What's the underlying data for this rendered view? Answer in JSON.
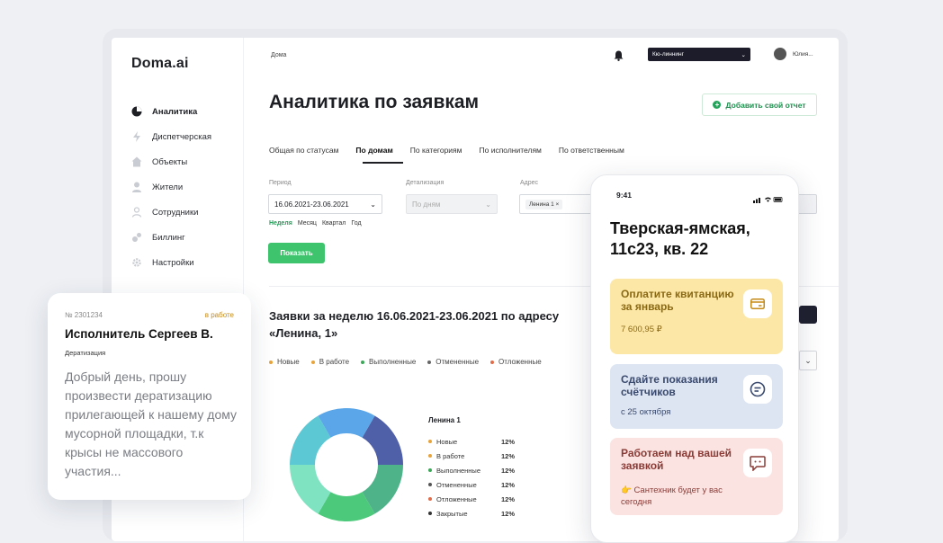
{
  "app": {
    "logo": "Doma.ai",
    "sidebar": [
      {
        "label": "Аналитика",
        "icon": "pie-chart-icon",
        "active": true
      },
      {
        "label": "Диспетчерская",
        "icon": "lightning-icon"
      },
      {
        "label": "Объекты",
        "icon": "house-icon"
      },
      {
        "label": "Жители",
        "icon": "person-icon"
      },
      {
        "label": "Сотрудники",
        "icon": "person-outline-icon"
      },
      {
        "label": "Биллинг",
        "icon": "wallet-icon"
      },
      {
        "label": "Настройки",
        "icon": "gear-icon"
      }
    ],
    "header": {
      "breadcrumb": "Дома",
      "organization": "Кю-линнинг",
      "user": "Юлия..."
    },
    "page_title": "Аналитика по заявкам",
    "add_report_label": "Добавить свой отчет",
    "tabs": [
      "Общая по статусам",
      "По домам",
      "По категориям",
      "По исполнителям",
      "По ответственным"
    ],
    "active_tab": 1,
    "filters": {
      "period_label": "Период",
      "period_value": "16.06.2021-23.06.2021",
      "detail_label": "Детализация",
      "detail_value": "По дням",
      "address_label": "Адрес",
      "address_chip": "Ленина 1",
      "periods": [
        "Неделя",
        "Месяц",
        "Квартал",
        "Год"
      ],
      "active_period": 0
    },
    "show_button": "Показать",
    "report_title": "Заявки за неделю 16.06.2021-23.06.2021 по адресу «Ленина, 1»",
    "legend": [
      {
        "label": "Новые",
        "color": "#e8a33a"
      },
      {
        "label": "В работе",
        "color": "#e8a33a"
      },
      {
        "label": "Выполненные",
        "color": "#3aa857"
      },
      {
        "label": "Отмененные",
        "color": "#666666"
      },
      {
        "label": "Отложенные",
        "color": "#e06c4a"
      }
    ]
  },
  "chart_data": {
    "type": "pie",
    "title": "Ленина 1",
    "categories": [
      "Новые",
      "В работе",
      "Выполненные",
      "Отмененные",
      "Отложенные",
      "Закрытые"
    ],
    "values": [
      12,
      12,
      12,
      12,
      12,
      12
    ],
    "value_labels": [
      "12%",
      "12%",
      "12%",
      "12%",
      "12%",
      "12%"
    ],
    "legend_colors": [
      "#e8a33a",
      "#e8a33a",
      "#3aa857",
      "#555555",
      "#e06c4a",
      "#333333"
    ],
    "slice_colors": [
      "#4f5fa8",
      "#4fb38a",
      "#4cc97a",
      "#7fe3c2",
      "#5cc8d4",
      "#5aa6e8"
    ]
  },
  "ticket": {
    "number": "№ 2301234",
    "status": "в работе",
    "executor": "Исполнитель Сергеев В.",
    "category": "Дератизация",
    "message": "Добрый день, прошу произвести дератизацию прилегающей к нашему дому мусорной площадки, т.к крысы не массового участия..."
  },
  "phone": {
    "time": "9:41",
    "address": "Тверская-ямская, 11с23, кв. 22",
    "cards": [
      {
        "title": "Оплатите квитанцию за январь",
        "subtitle": "7 600,95 ₽",
        "icon": "card-icon"
      },
      {
        "title": "Сдайте показания счётчиков",
        "subtitle": "с 25 октября",
        "icon": "meter-icon"
      },
      {
        "title": "Работаем над вашей заявкой",
        "subtitle": "👉 Сантехник будет у вас сегодня",
        "icon": "chat-icon"
      }
    ]
  }
}
